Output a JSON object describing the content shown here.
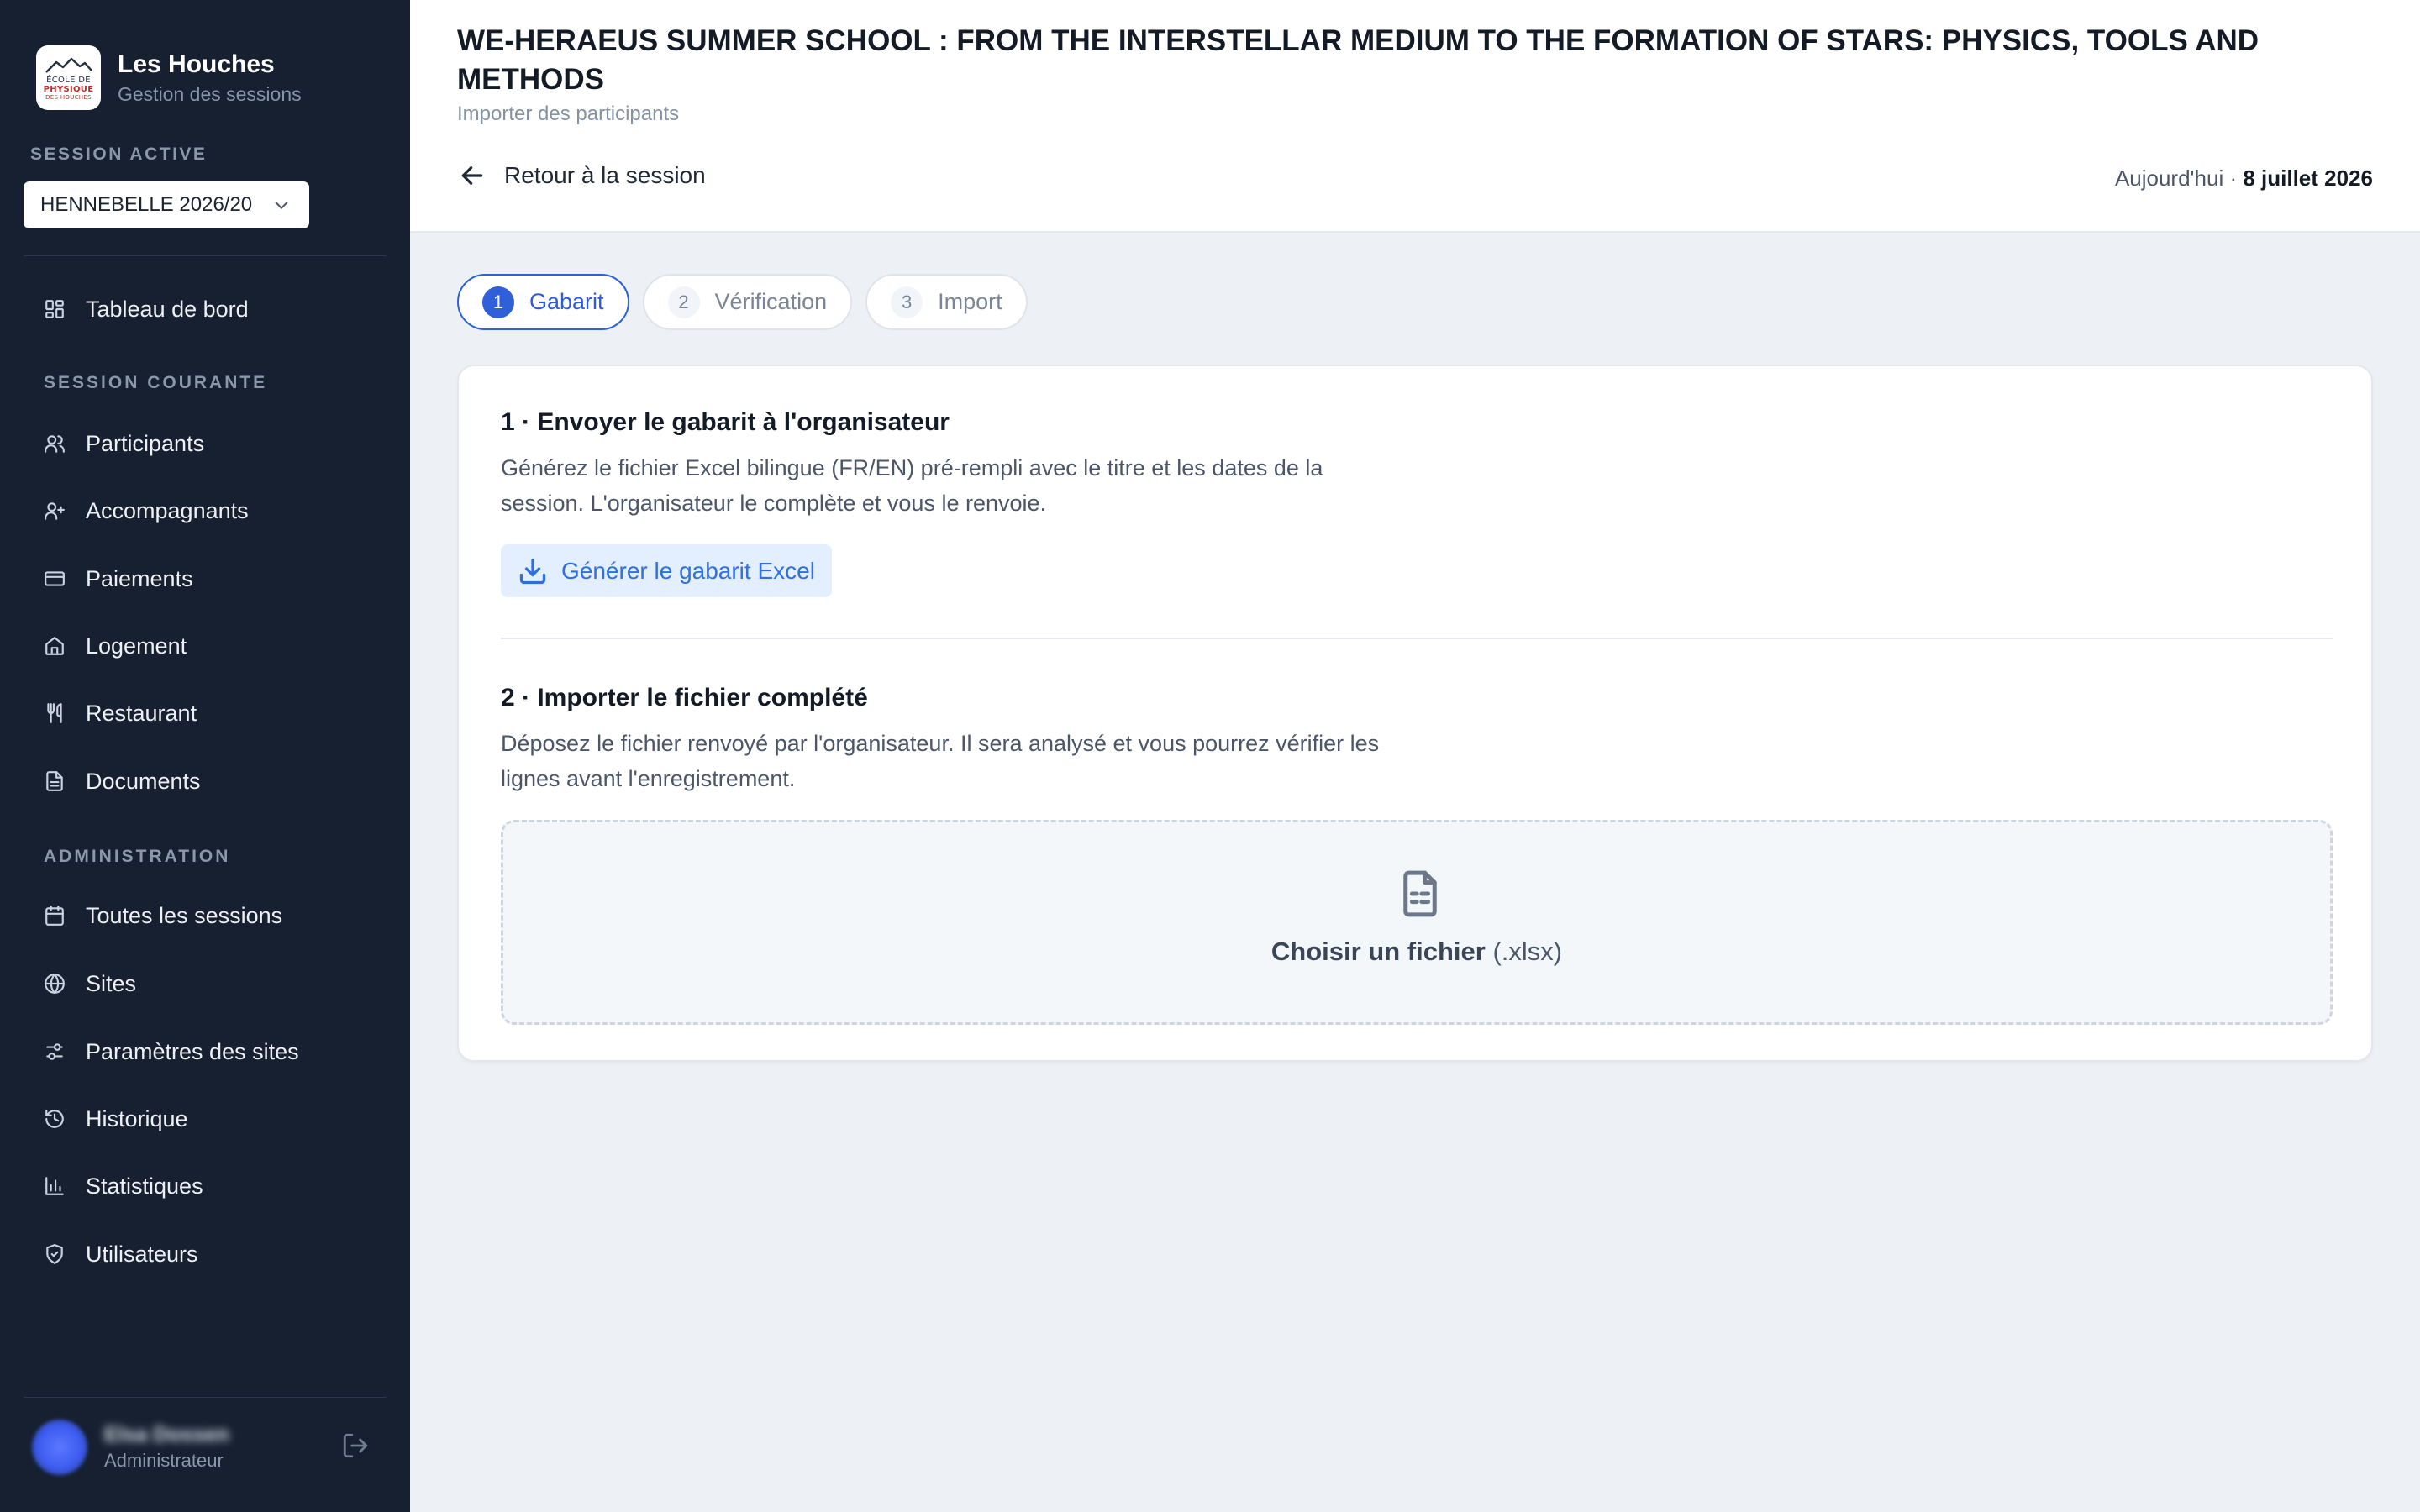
{
  "sidebar": {
    "brand_title": "Les Houches",
    "brand_subtitle": "Gestion des sessions",
    "logo_lines": [
      "ÉCOLE DE",
      "PHYSIQUE",
      "DES HOUCHES"
    ],
    "session_label": "SESSION ACTIVE",
    "session_value": "HENNEBELLE 2026/20",
    "dashboard": "Tableau de bord",
    "section_current": "SESSION COURANTE",
    "current_items": [
      "Participants",
      "Accompagnants",
      "Paiements",
      "Logement",
      "Restaurant",
      "Documents"
    ],
    "section_admin": "ADMINISTRATION",
    "admin_items": [
      "Toutes les sessions",
      "Sites",
      "Paramètres des sites",
      "Historique",
      "Statistiques",
      "Utilisateurs"
    ],
    "user_name": "Elsa Dossen",
    "user_role": "Administrateur"
  },
  "header": {
    "title": "WE-HERAEUS SUMMER SCHOOL : FROM THE INTERSTELLAR MEDIUM TO THE FORMATION OF STARS: PHYSICS, TOOLS AND METHODS",
    "subtitle": "Importer des participants",
    "back_label": "Retour à la session",
    "today_label": "Aujourd'hui ·",
    "today_date": "8 juillet 2026"
  },
  "steps": [
    {
      "num": "1",
      "label": "Gabarit",
      "active": true
    },
    {
      "num": "2",
      "label": "Vérification",
      "active": false
    },
    {
      "num": "3",
      "label": "Import",
      "active": false
    }
  ],
  "card": {
    "section1_title": "1 · Envoyer le gabarit à l'organisateur",
    "section1_desc": "Générez le fichier Excel bilingue (FR/EN) pré-rempli avec le titre et les dates de la session. L'organisateur le complète et vous le renvoie.",
    "generate_button": "Générer le gabarit Excel",
    "section2_title": "2 · Importer le fichier complété",
    "section2_desc": "Déposez le fichier renvoyé par l'organisateur. Il sera analysé et vous pourrez vérifier les lignes avant l'enregistrement.",
    "dropzone_label": "Choisir un fichier",
    "dropzone_ext": "(.xlsx)"
  },
  "colors": {
    "sidebar_bg": "#162030",
    "accent": "#2f5fd9",
    "button_bg": "#e3efff",
    "page_bg": "#edf1f5"
  }
}
